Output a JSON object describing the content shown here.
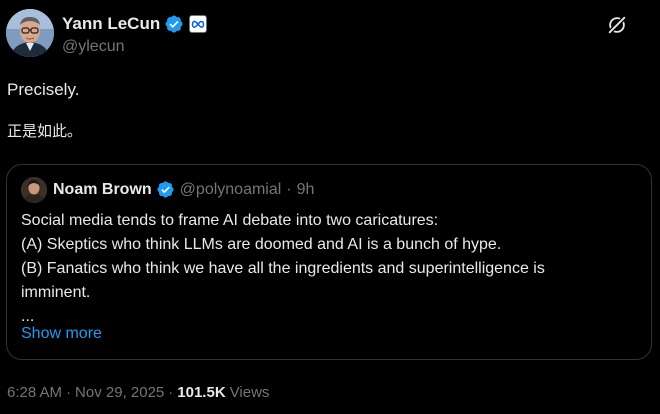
{
  "author": {
    "display_name": "Yann LeCun",
    "handle": "@ylecun",
    "verified_icon": "verified-badge-icon",
    "affiliation_icon": "meta-logo-icon"
  },
  "post": {
    "text": "Precisely.",
    "translation": "正是如此。"
  },
  "quoted": {
    "display_name": "Noam Brown",
    "handle": "@polynoamial",
    "separator": "·",
    "age": "9h",
    "lines": [
      "Social media tends to frame AI debate into two caricatures:",
      "(A) Skeptics who think LLMs are doomed and AI is a bunch of hype.",
      "(B) Fanatics who think we have all the ingredients and superintelligence is",
      "imminent.",
      "..."
    ],
    "show_more": "Show more"
  },
  "meta": {
    "time": "6:28 AM",
    "separator": "·",
    "date": "Nov 29, 2025",
    "views_count": "101.5K",
    "views_label": "Views"
  },
  "colors": {
    "background": "#000000",
    "text": "#e7e9ea",
    "secondary": "#71767b",
    "link": "#1d9bf0",
    "border": "#2f3336",
    "verified": "#1d9bf0"
  }
}
